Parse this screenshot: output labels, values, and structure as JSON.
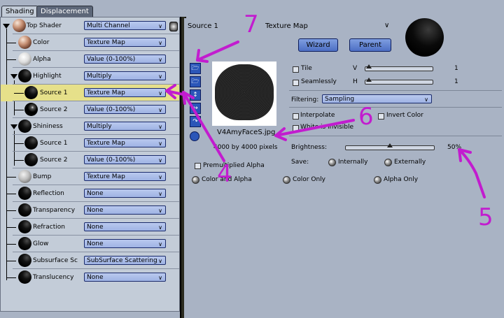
{
  "tabs": [
    {
      "label": "Shading"
    },
    {
      "label": "Displacement"
    }
  ],
  "tree": [
    {
      "label": "Top Shader",
      "dropdown": "Multi Channel",
      "sphere": "skin"
    },
    {
      "label": "Color",
      "dropdown": "Texture Map",
      "sphere": "skin"
    },
    {
      "label": "Alpha",
      "dropdown": "Value (0-100%)",
      "sphere": "white"
    },
    {
      "label": "Highlight",
      "dropdown": "Multiply",
      "sphere": "dark"
    },
    {
      "label": "Source 1",
      "dropdown": "Texture Map",
      "sphere": "dark"
    },
    {
      "label": "Source 2",
      "dropdown": "Value (0-100%)",
      "sphere": "speck"
    },
    {
      "label": "Shininess",
      "dropdown": "Multiply",
      "sphere": "dark"
    },
    {
      "label": "Source 1",
      "dropdown": "Texture Map",
      "sphere": "dark"
    },
    {
      "label": "Source 2",
      "dropdown": "Value (0-100%)",
      "sphere": "dark"
    },
    {
      "label": "Bump",
      "dropdown": "Texture Map",
      "sphere": "grey"
    },
    {
      "label": "Reflection",
      "dropdown": "None",
      "sphere": "dark"
    },
    {
      "label": "Transparency",
      "dropdown": "None",
      "sphere": "dark"
    },
    {
      "label": "Refraction",
      "dropdown": "None",
      "sphere": "dark"
    },
    {
      "label": "Glow",
      "dropdown": "None",
      "sphere": "dark"
    },
    {
      "label": "Subsurface Sc",
      "dropdown": "SubSurface Scattering",
      "sphere": "dark"
    },
    {
      "label": "Translucency",
      "dropdown": "None",
      "sphere": "dark"
    }
  ],
  "right": {
    "header_source": "Source 1",
    "header_type": "Texture Map",
    "wizard": "Wizard",
    "parent": "Parent",
    "tile": "Tile",
    "seamlessly": "Seamlessly",
    "v": "V",
    "h": "H",
    "v_value": "1",
    "h_value": "1",
    "filtering_label": "Filtering:",
    "filtering_value": "Sampling",
    "interpolate": "Interpolate",
    "invert_color": "Invert Color",
    "white_invisible": "White is invisible",
    "filename": "V4AmyFaceS.jpg",
    "dimensions": "4000 by 4000 pixels",
    "brightness_label": "Brightness:",
    "brightness_value": "50%",
    "brightness_level": 0.5,
    "save_label": "Save:",
    "internally": "Internally",
    "externally": "Externally",
    "premultiplied": "Premultiplied Alpha",
    "color_alpha": "Color and Alpha",
    "color_only": "Color Only",
    "alpha_only": "Alpha Only"
  },
  "annotations": [
    "4",
    "5",
    "6",
    "7"
  ],
  "colors": {
    "annotation": "#c21ccf",
    "selected_row": "#e6e08a",
    "dropdown": "#a9bcea"
  }
}
